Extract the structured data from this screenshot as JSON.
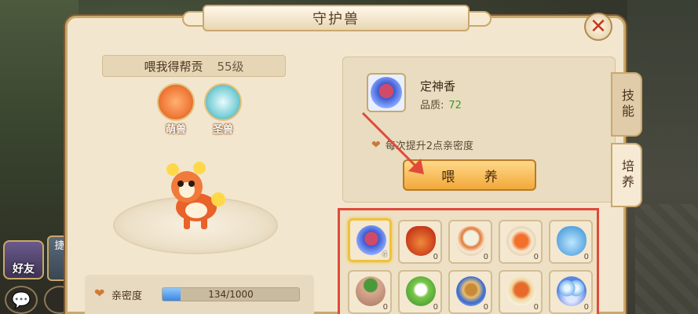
{
  "window": {
    "title": "守护兽",
    "close": "✕"
  },
  "hud": {
    "friends_label": "好友",
    "side_button_2_label": "捷",
    "chat_icon": "💬"
  },
  "pet": {
    "name": "喂我得帮贡",
    "level": "55级",
    "forms": [
      {
        "label": "萌兽",
        "color": "#f07a3a"
      },
      {
        "label": "圣兽",
        "color": "#7acfd6"
      }
    ],
    "intimacy_label": "亲密度",
    "intimacy_text": "134/1000",
    "intimacy_progress": 0.134
  },
  "selected_item": {
    "name": "定神香",
    "quality_label": "品质:",
    "quality_value": "72",
    "description": "每次提升2点亲密度",
    "feed_button": "喂 养"
  },
  "tabs": [
    {
      "label": "技能",
      "active": false
    },
    {
      "label": "培养",
      "active": true
    }
  ],
  "inventory": [
    {
      "icon": "bowl-blue",
      "count": "4",
      "selected": true
    },
    {
      "icon": "bag-red",
      "count": "0"
    },
    {
      "icon": "plate-rice",
      "count": "0"
    },
    {
      "icon": "plate-fish",
      "count": "0"
    },
    {
      "icon": "bag-blue",
      "count": "0"
    },
    {
      "icon": "pot-green",
      "count": "0"
    },
    {
      "icon": "leaf-rice",
      "count": "0"
    },
    {
      "icon": "bowl-noodle",
      "count": "0"
    },
    {
      "icon": "bowl-stew",
      "count": "0"
    },
    {
      "icon": "balls-blue",
      "count": "0"
    }
  ],
  "colors": {
    "highlight_red": "#e04a3a",
    "accent_gold": "#f2a93a"
  }
}
